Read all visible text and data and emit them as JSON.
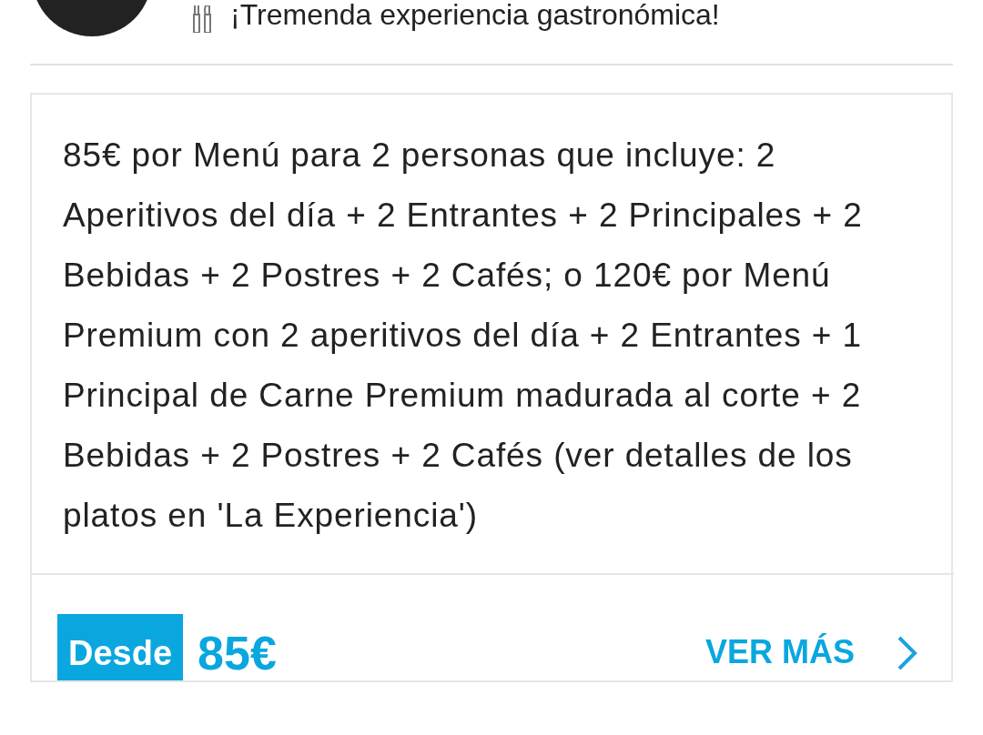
{
  "review": {
    "title": "¡Tremenda experiencia gastronómica!"
  },
  "offer": {
    "description": "85€ por Menú para 2 personas que incluye: 2 Aperitivos del día + 2 Entrantes + 2 Principales + 2 Bebidas + 2 Postres + 2 Cafés; o 120€ por Menú Premium con 2 aperitivos del día + 2 Entrantes + 1 Principal de Carne Premium madurada al corte + 2 Bebidas + 2 Postres + 2 Cafés (ver detalles de los platos en 'La Experiencia')",
    "price_prefix": "Desde",
    "price": "85€",
    "more_link": "VER MÁS"
  }
}
